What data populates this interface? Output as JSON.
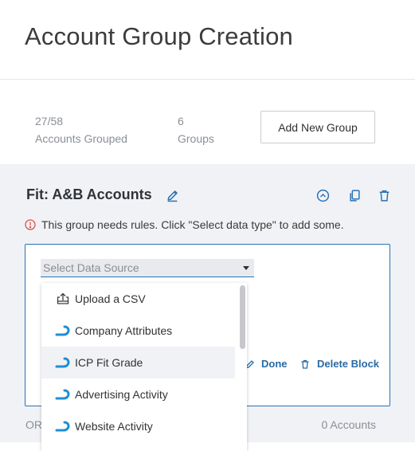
{
  "page": {
    "title": "Account Group Creation"
  },
  "stats": {
    "grouped_value": "27/58",
    "grouped_label": "Accounts Grouped",
    "groups_value": "6",
    "groups_label": "Groups",
    "add_button": "Add New Group"
  },
  "group": {
    "name": "Fit: A&B Accounts",
    "warning": "This group needs rules. Click \"Select data type\" to add some.",
    "done_label": "Done",
    "delete_block_label": "Delete Block",
    "or_label": "OR",
    "accounts_count": "0 Accounts",
    "icons": [
      "pencil-icon",
      "collapse-up-icon",
      "copy-icon",
      "trash-icon"
    ]
  },
  "select": {
    "placeholder": "Select Data Source"
  },
  "dropdown": {
    "items": [
      {
        "label": "Upload a CSV",
        "icon": "upload-icon"
      },
      {
        "label": "Company Attributes",
        "icon": "brand-swoosh-icon"
      },
      {
        "label": "ICP Fit Grade",
        "icon": "brand-swoosh-icon"
      },
      {
        "label": "Advertising Activity",
        "icon": "brand-swoosh-icon"
      },
      {
        "label": "Website Activity",
        "icon": "brand-swoosh-icon"
      }
    ],
    "highlighted_index": 2
  },
  "colors": {
    "accent": "#2a73b3",
    "warning": "#d9534f",
    "brand_icon": "#1e8fd6",
    "panel": "#f1f2f5"
  }
}
